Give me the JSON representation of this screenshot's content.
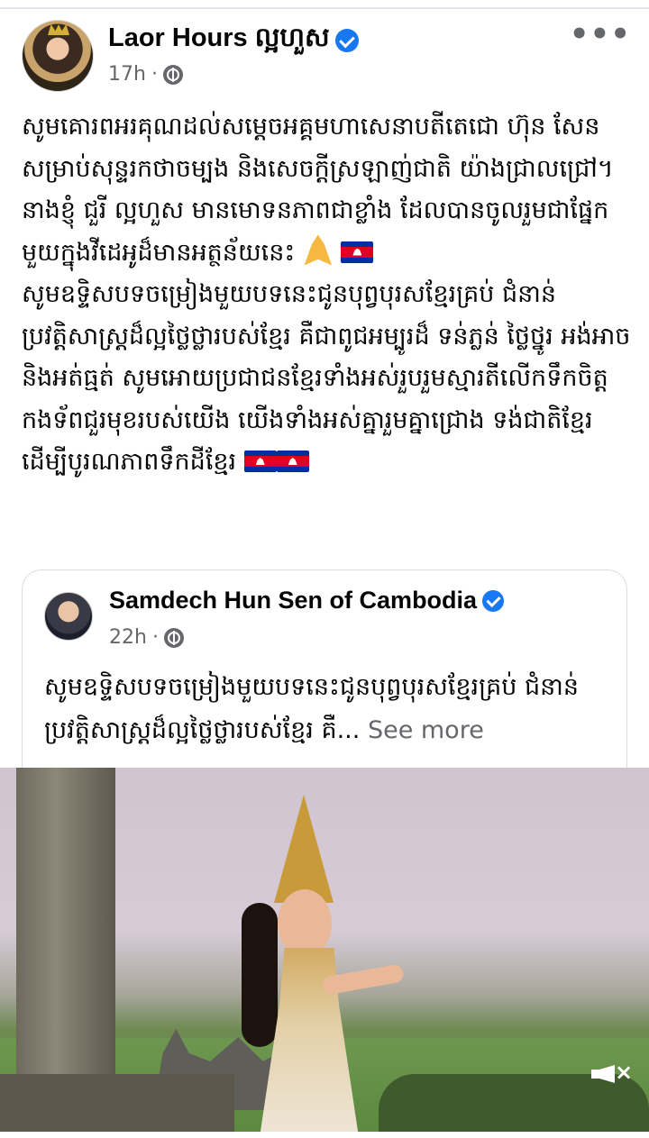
{
  "post": {
    "author": "Laor Hours ល្អហួស",
    "time": "17h",
    "dot": "·",
    "more_icon": "more-horizontal-icon",
    "paragraph1": "សូមគោរពអរគុណដល់សម្តេចអគ្គមហាសេនាបតីតេជោ ហ៊ុន សែន សម្រាប់សុន្ទរកថាចម្បង និងសេចក្តីស្រឡាញ់ជាតិ យ៉ាងជ្រាលជ្រៅ។ នាងខ្ញុំ ជួរី ល្អហួស មានមោទនភាពជាខ្លាំង ដែលបានចូលរួមជាផ្នែកមួយក្នុងវីដេអូដ៏មានអត្ថន័យនេះ",
    "paragraph2": "សូមឧទ្ទិសបទចម្រៀងមួយបទនេះជូនបុព្វបុរសខ្មែរគ្រប់ ជំនាន់ ប្រវត្តិសាស្ត្រដ៏ល្អថ្លៃថ្លារបស់ខ្មែរ គឺជាពូជអម្បូរដ៏ ទន់ភ្លន់ ថ្លៃថ្នូរ អង់អាច និងអត់ធ្មត់ សូមអោយប្រជាជនខ្មែរទាំងអស់រួបរួមស្មារតីលើកទឹកចិត្ត កងទ័ពជួរមុខរបស់យើង យើងទាំងអស់គ្នារួមគ្នាជ្រោង ទង់ជាតិខ្មែរដើម្បីបូរណភាពទឹកដីខ្មែរ"
  },
  "shared": {
    "author": "Samdech Hun Sen of Cambodia",
    "time": "22h",
    "dot": "·",
    "text": "សូមឧទ្ទិសបទចម្រៀងមួយបទនេះជូនបុព្វបុរសខ្មែរគ្រប់ ជំនាន់ ប្រវត្តិសាស្ត្រដ៏ល្អថ្លៃថ្លារបស់ខ្មែរ គឺ...",
    "see_more": "See more"
  },
  "video": {
    "mute_icon": "volume-muted-icon"
  },
  "colors": {
    "verified": "#1877f2",
    "meta_text": "#65676b",
    "body_text": "#050505"
  }
}
